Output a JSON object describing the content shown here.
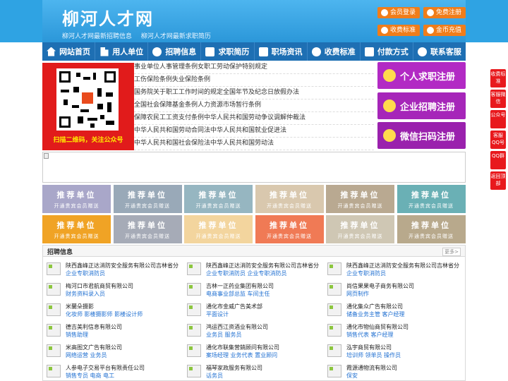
{
  "header": {
    "logo": "柳河人才网",
    "slogan_1": "柳河人才网最新招聘信息",
    "slogan_2": "柳河人才网最新求职简历",
    "buttons": {
      "login": "会员登录",
      "register": "免费注册",
      "pricing": "收费标准",
      "recharge": "金币充值"
    },
    "accent_color": "#f07d1a"
  },
  "nav": {
    "items": [
      {
        "label": "网站首页",
        "icon": "home-icon"
      },
      {
        "label": "用人单位",
        "icon": "building-icon"
      },
      {
        "label": "招聘信息",
        "icon": "recruit-icon"
      },
      {
        "label": "求职简历",
        "icon": "resume-icon"
      },
      {
        "label": "职场资讯",
        "icon": "news-icon"
      },
      {
        "label": "收费标准",
        "icon": "pricing-icon"
      },
      {
        "label": "付款方式",
        "icon": "payment-icon"
      },
      {
        "label": "联系客服",
        "icon": "service-icon"
      }
    ]
  },
  "qr": {
    "caption": "扫描二维码，关注公众号"
  },
  "regulations": {
    "left": [
      "事业单位人事管理条例",
      "工伤保险条例",
      "国务院关于职工工作时间的规定",
      "全国社会保障基金条例",
      "保障农民工工资支付条例",
      "中华人民共和国劳动合同法",
      "中华人民共和国社会保险法"
    ],
    "right": [
      "女职工劳动保护特别规定",
      "失业保险条例",
      "全国年节及纪念日放假办法",
      "人力资源市场暂行条例",
      "中华人民共和国劳动争议调解仲裁法",
      "中华人民共和国就业促进法",
      "中华人民共和国劳动法"
    ]
  },
  "register_buttons": {
    "personal": "个人求职注册",
    "company": "企业招聘注册",
    "wechat": "微信扫码注册"
  },
  "recommend": {
    "title": "推荐单位",
    "subtitle": "开通贵宾会员赠送",
    "colors": [
      "#a9a7c9",
      "#99a9b8",
      "#96b6c1",
      "#d9c8ae",
      "#b9a991",
      "#6ab0b5",
      "#f0a325",
      "#a6abb7",
      "#f3d59e",
      "#f07a55",
      "#cfc7b4",
      "#b8a98c"
    ]
  },
  "jobs": {
    "title": "招聘信息",
    "more": "更多>",
    "rows": [
      [
        {
          "company": "陕西鑫峰正达消防安全服务有限公司吉林省分",
          "positions": "企业专职消防员"
        },
        {
          "company": "陕西鑫峰正达消防安全服务有限公司吉林省分",
          "positions": "企业专职消防员 企业专职消防员"
        },
        {
          "company": "陕西鑫峰正达消防安全服务有限公司吉林省分",
          "positions": "企业专职消防员"
        }
      ],
      [
        {
          "company": "梅河口市君航商贸有限公司",
          "positions": "财务资料录入员"
        },
        {
          "company": "吉林一正药业集团有限公司",
          "positions": "电商事业部总监 车间主任"
        },
        {
          "company": "尚信果果电子商务有限公司",
          "positions": "网页制作"
        }
      ],
      [
        {
          "company": "米蘭朵摄影",
          "positions": "化妆师 影楼摄影师 影楼设计师"
        },
        {
          "company": "通化市金威广告美术部",
          "positions": "平面设计"
        },
        {
          "company": "通化集众广告有限公司",
          "positions": "储备业务主管 客户经理"
        }
      ],
      [
        {
          "company": "德吉美利信息有限公司",
          "positions": "销售助理"
        },
        {
          "company": "鸿运西江资酒业有限公司",
          "positions": "业务员 服务员"
        },
        {
          "company": "通化市物仙商贸有限公司",
          "positions": "销售代表 客户经理"
        }
      ],
      [
        {
          "company": "米高图文广告有限公司",
          "positions": "网络运营 业务员"
        },
        {
          "company": "通化市联集营銷顾问有限公司",
          "positions": "案场经理 业务代表 置业顾问"
        },
        {
          "company": "泓宇商贸有限公司",
          "positions": "培训师 领单员 操作员"
        }
      ],
      [
        {
          "company": "人参电子交易平台有限责任公司",
          "positions": "销售专员 电商 电工"
        },
        {
          "company": "福琴家政服务有限公司",
          "positions": "话务员"
        },
        {
          "company": "霞源通物流有限公司",
          "positions": "保安"
        }
      ]
    ]
  },
  "side_float": [
    {
      "label": "收费标准"
    },
    {
      "label": "客服微信"
    },
    {
      "label": "公众号"
    },
    {
      "label": "客服QQ号"
    },
    {
      "label": "QQ群"
    },
    {
      "label": "返回顶部"
    }
  ]
}
